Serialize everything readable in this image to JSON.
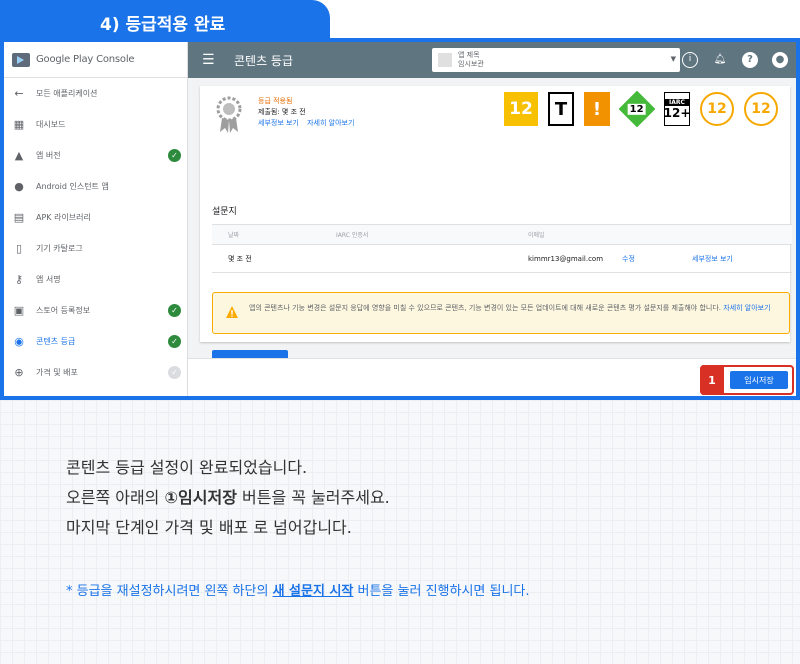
{
  "step_tab": {
    "title": "4) 등급적용 완료"
  },
  "sidebar": {
    "logo": "Google Play Console",
    "items": [
      {
        "icon": "arrow-left-icon",
        "label": "모든 애플리케이션",
        "status": ""
      },
      {
        "icon": "dashboard-icon",
        "label": "대시보드",
        "status": ""
      },
      {
        "icon": "rocket-icon",
        "label": "앱 버전",
        "status": "complete"
      },
      {
        "icon": "android-instant-icon",
        "label": "Android 인스턴트 앱",
        "status": ""
      },
      {
        "icon": "apk-library-icon",
        "label": "APK 라이브러리",
        "status": ""
      },
      {
        "icon": "device-catalog-icon",
        "label": "기기 카탈로그",
        "status": ""
      },
      {
        "icon": "key-icon",
        "label": "앱 서명",
        "status": ""
      },
      {
        "icon": "store-listing-icon",
        "label": "스토어 등록정보",
        "status": "complete"
      },
      {
        "icon": "content-rating-icon",
        "label": "콘텐츠 등급",
        "status": "complete",
        "active": true
      },
      {
        "icon": "globe-icon",
        "label": "가격 및 배포",
        "status": "pending"
      }
    ]
  },
  "topbar": {
    "title": "콘텐츠 등급",
    "app_select": {
      "line1": "앱 제목",
      "line2": "임시보관"
    }
  },
  "rating": {
    "status": "등급 적용됨",
    "submitter": "제출됨: 몇 조 전",
    "link_details": "세부정보 보기",
    "link_learn": "자세히 알아보기",
    "icons": [
      {
        "name": "rating-12-yellow-icon",
        "text": "12"
      },
      {
        "name": "esrb-teen-icon",
        "text": "T"
      },
      {
        "name": "pegi-warning-icon",
        "text": "!"
      },
      {
        "name": "usk-12-icon",
        "text": "12"
      },
      {
        "name": "iarc-12-icon",
        "text": "12+",
        "top": "IARC"
      },
      {
        "name": "rating-12-circle-icon",
        "text": "12"
      },
      {
        "name": "rating-12-circle-icon-2",
        "text": "12"
      }
    ]
  },
  "questionnaire": {
    "title": "설문지",
    "columns": [
      "날짜",
      "IARC 인증서",
      "이메일"
    ],
    "rows": [
      {
        "date": "몇 조 전",
        "cert": "",
        "email": "kimmr13@gmail.com",
        "edit": "수정",
        "details": "세부정보 보기"
      }
    ]
  },
  "warning": {
    "text": "앱의 콘텐츠나 기능 변경은 설문지 응답에 영향을 미칠 수 있으므로 콘텐츠, 기능 변경이 있는 모든 업데이트에 대해 새로운 콘텐츠 평가 설문지를 제출해야 합니다.",
    "link": "자세히 알아보기"
  },
  "new_questionnaire_button": "새 설문지 시작",
  "callout": {
    "number": "1",
    "save_button": "임시저장"
  },
  "instructions": {
    "line1": "콘텐츠 등급 설정이 완료되었습니다.",
    "line2_pre": "오른쪽 아래의 ",
    "line2_bold": "①임시저장",
    "line2_post": " 버튼을 꼭 눌러주세요.",
    "line3": "마지막 단계인 가격 및 배포 로 넘어갑니다.",
    "note_pre": "* 등급을 재설정하시려면 왼쪽 하단의 ",
    "note_bold": "새 설문지 시작",
    "note_post": " 버튼을 눌러 진행하시면 됩니다."
  },
  "colors": {
    "accent": "#1a73e8",
    "topbar": "#5f7580",
    "success": "#2e8b3d",
    "callout": "#d93025",
    "warning": "#f9ab00"
  }
}
